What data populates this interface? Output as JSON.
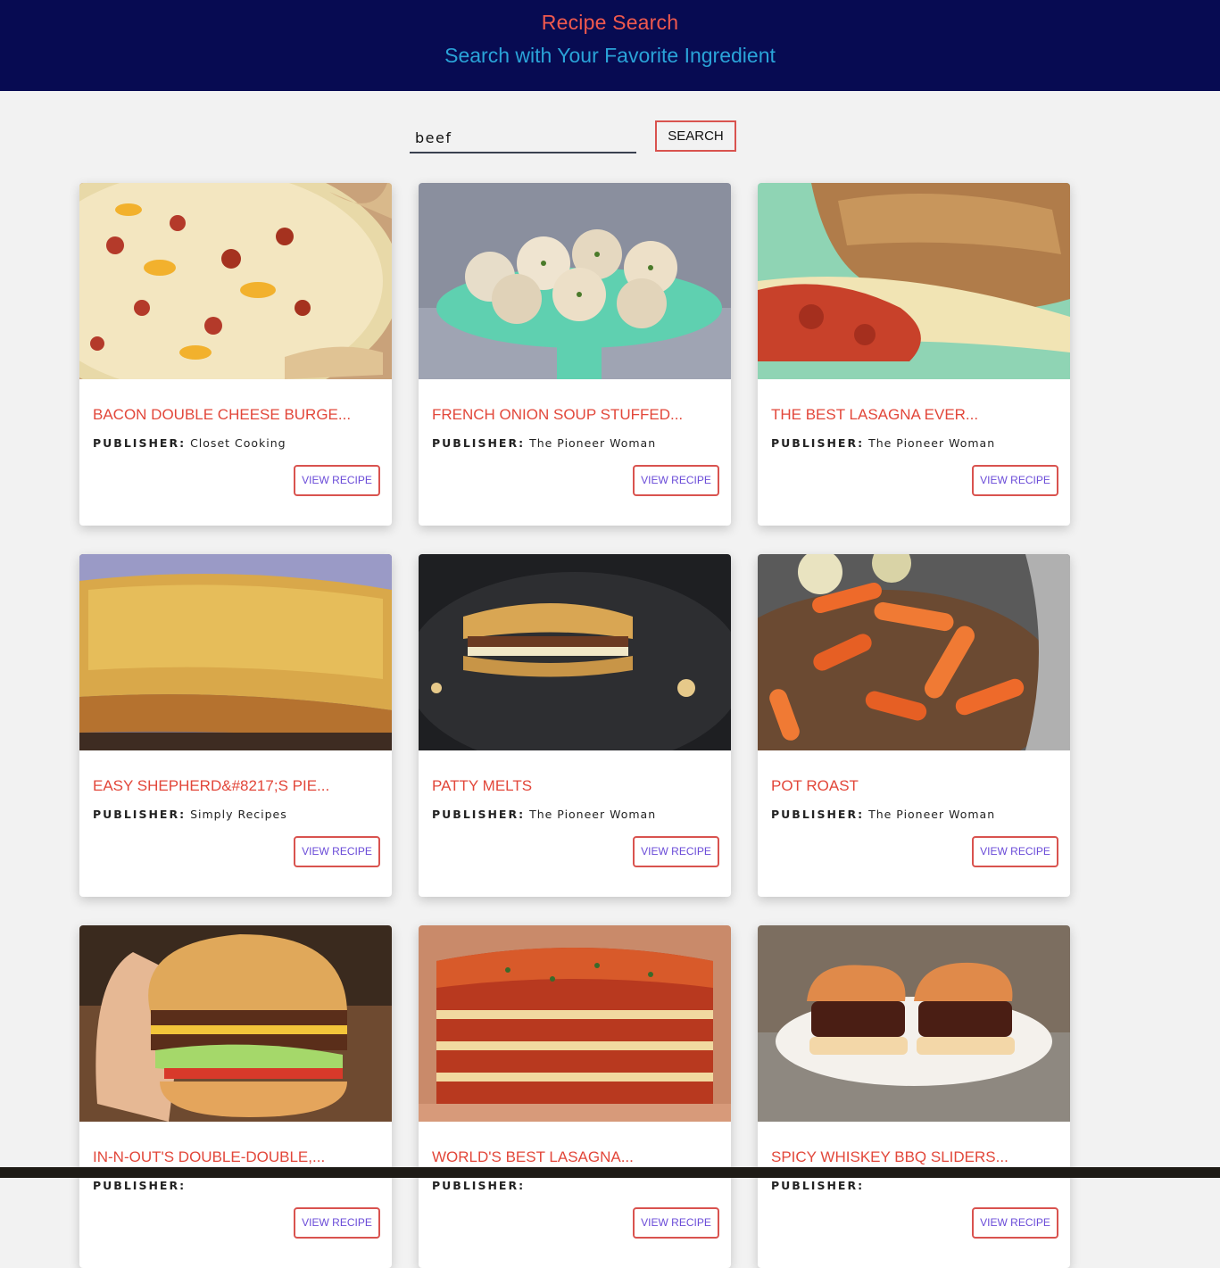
{
  "header": {
    "title": "Recipe Search",
    "subtitle": "Search with Your Favorite Ingredient"
  },
  "search": {
    "value": "beef",
    "button_label": "SEARCH"
  },
  "publisher_label": "PUBLISHER:",
  "view_label": "VIEW RECIPE",
  "recipes": [
    {
      "title": "BACON DOUBLE CHEESE BURGE...",
      "publisher": "Closet Cooking"
    },
    {
      "title": "FRENCH ONION SOUP STUFFED...",
      "publisher": "The Pioneer Woman"
    },
    {
      "title": "THE BEST LASAGNA EVER...",
      "publisher": "The Pioneer Woman"
    },
    {
      "title": "EASY SHEPHERD&#8217;S PIE...",
      "publisher": "Simply Recipes"
    },
    {
      "title": "PATTY MELTS",
      "publisher": "The Pioneer Woman"
    },
    {
      "title": "POT ROAST",
      "publisher": "The Pioneer Woman"
    },
    {
      "title": "IN-N-OUT'S DOUBLE-DOUBLE,...",
      "publisher": ""
    },
    {
      "title": "WORLD'S BEST LASAGNA...",
      "publisher": ""
    },
    {
      "title": "SPICY WHISKEY BBQ SLIDERS...",
      "publisher": ""
    }
  ],
  "colors": {
    "header_bg": "#070b52",
    "title": "#f0594e",
    "subtitle": "#2aa3d8",
    "accent": "#d9534f",
    "button_text": "#6a4bd8"
  }
}
